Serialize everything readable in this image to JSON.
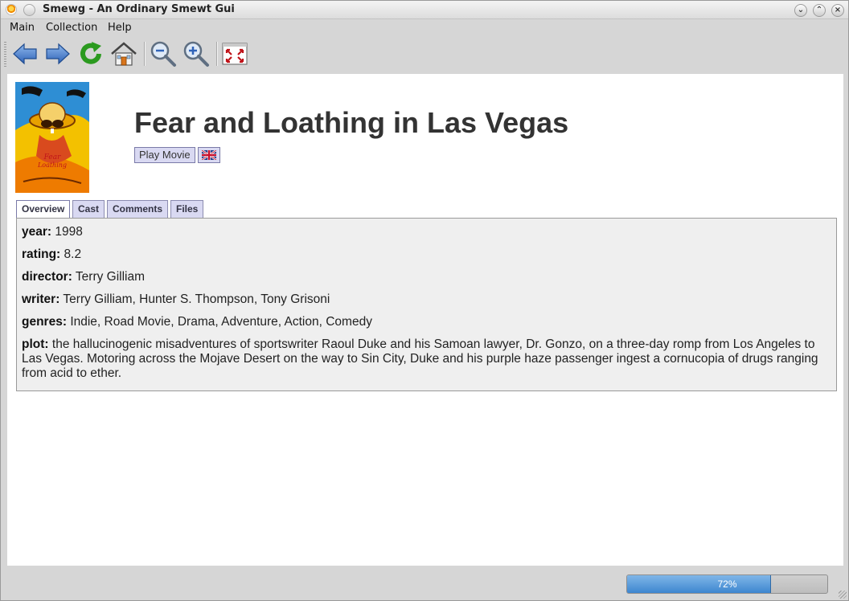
{
  "window": {
    "title": "Smewg - An Ordinary Smewt Gui",
    "controls": [
      "minimize",
      "maximize",
      "close"
    ]
  },
  "menubar": {
    "items": [
      {
        "label": "Main"
      },
      {
        "label": "Collection"
      },
      {
        "label": "Help"
      }
    ]
  },
  "toolbar": {
    "buttons": [
      {
        "icon": "back-arrow-icon"
      },
      {
        "icon": "forward-arrow-icon"
      },
      {
        "icon": "refresh-icon"
      },
      {
        "icon": "home-icon"
      },
      {
        "icon": "zoom-out-icon"
      },
      {
        "icon": "zoom-in-icon"
      },
      {
        "icon": "fullscreen-icon"
      }
    ]
  },
  "movie": {
    "title": "Fear and Loathing in Las Vegas",
    "play_label": "Play Movie",
    "subtitle_flag": "uk-flag-icon",
    "poster_icon": "movie-poster-image"
  },
  "tabs": [
    {
      "label": "Overview",
      "active": true
    },
    {
      "label": "Cast",
      "active": false
    },
    {
      "label": "Comments",
      "active": false
    },
    {
      "label": "Files",
      "active": false
    }
  ],
  "overview": {
    "year_label": "year:",
    "year": "1998",
    "rating_label": "rating:",
    "rating": "8.2",
    "director_label": "director:",
    "director": "Terry Gilliam",
    "writer_label": "writer:",
    "writer": "Terry Gilliam, Hunter S. Thompson, Tony Grisoni",
    "genres_label": "genres:",
    "genres": "Indie, Road Movie, Drama, Adventure, Action, Comedy",
    "plot_label": "plot:",
    "plot": "the hallucinogenic misadventures of sportswriter Raoul Duke and his Samoan lawyer, Dr. Gonzo, on a three-day romp from Los Angeles to Las Vegas. Motoring across the Mojave Desert on the way to Sin City, Duke and his purple haze passenger ingest a cornucopia of drugs ranging from acid to ether."
  },
  "status": {
    "progress_percent": 72,
    "progress_text": "72%"
  },
  "colors": {
    "tab_bg": "#d9d9f2",
    "progress_fill": "#3d86cf",
    "title_text": "#333333"
  }
}
